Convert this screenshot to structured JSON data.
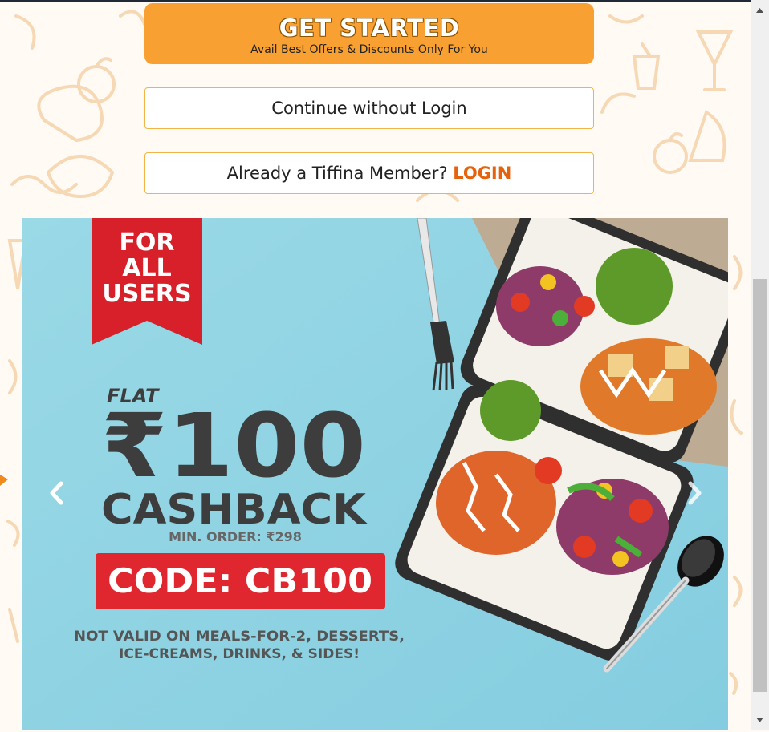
{
  "actions": {
    "get_started_label": "GET STARTED",
    "get_started_sub": "Avail Best Offers & Discounts Only For You",
    "continue_label": "Continue without Login",
    "member_prompt": "Already a Tiffina Member?",
    "login_link": "LOGIN"
  },
  "banner": {
    "ribbon_lines": [
      "FOR",
      "ALL",
      "USERS"
    ],
    "flat": "FLAT",
    "amount": "₹100",
    "cashback": "CASHBACK",
    "min_order": "MIN. ORDER: ₹298",
    "code": "CODE: CB100",
    "disclaimer_line1": "NOT VALID ON MEALS-FOR-2, DESSERTS,",
    "disclaimer_line2": "ICE-CREAMS, DRINKS, & SIDES!"
  },
  "icons": {
    "prev": "chevron-left-icon",
    "next": "chevron-right-icon",
    "scroll_up": "triangle-up-icon",
    "scroll_down": "triangle-down-icon"
  },
  "colors": {
    "accent_orange": "#f8a132",
    "login_orange": "#e5630c",
    "code_red": "#e0262e",
    "banner_blue": "#8fd3e2",
    "outline_border": "#f3b447"
  }
}
